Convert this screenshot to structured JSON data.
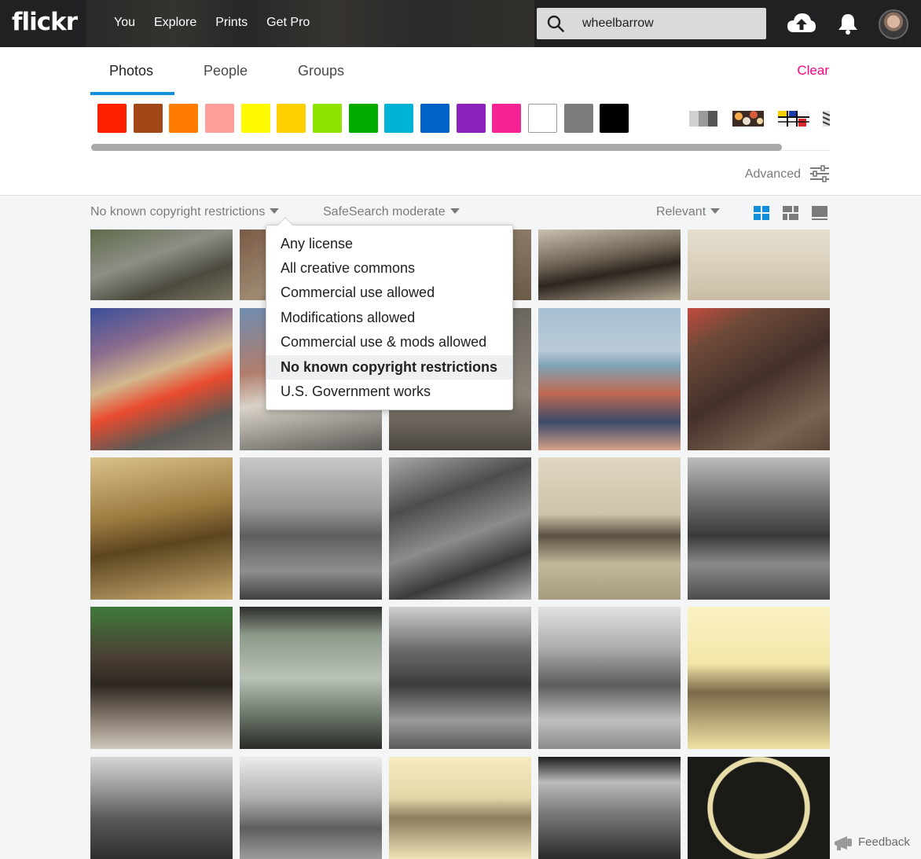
{
  "header": {
    "logo": "flickr",
    "nav": [
      "You",
      "Explore",
      "Prints",
      "Get Pro"
    ],
    "search_value": "wheelbarrow"
  },
  "tabs": [
    "Photos",
    "People",
    "Groups"
  ],
  "active_tab": "Photos",
  "clear_label": "Clear",
  "colors": [
    "#ff2000",
    "#a24615",
    "#ff7c00",
    "#ff9f9c",
    "#fffa00",
    "#ffcf00",
    "#90e200",
    "#00ab00",
    "#00b2d4",
    "#0062c6",
    "#8c20ba",
    "#f52394",
    "#ffffff",
    "#7c7c7c",
    "#000000"
  ],
  "styles": [
    "black-and-white-icon",
    "shallow-depth-of-field-icon",
    "minimalism-icon",
    "patterns-icon"
  ],
  "advanced_label": "Advanced",
  "filters": {
    "license": "No known copyright restrictions",
    "safesearch": "SafeSearch moderate",
    "sort": "Relevant"
  },
  "license_options": [
    "Any license",
    "All creative commons",
    "Commercial use allowed",
    "Modifications allowed",
    "Commercial use & mods allowed",
    "No known copyright restrictions",
    "U.S. Government works"
  ],
  "selected_license": "No known copyright restrictions",
  "accent": "#128fdc",
  "clear_color": "#ff0084",
  "photos": [
    {
      "name": "wheelbarrow-in-garden",
      "bg": "linear-gradient(160deg,#5e6b4a 0%,#8d8f86 40%,#4c4a3f 70%,#7a7560 100%)"
    },
    {
      "name": "people-street-1",
      "bg": "linear-gradient(150deg,#7a5a46 0%,#9e8a72 50%,#5b4a3a 100%)"
    },
    {
      "name": "hidden-photo-3",
      "bg": "linear-gradient(180deg,#8a7a66,#6b5a48)"
    },
    {
      "name": "sepia-figure-beach",
      "bg": "linear-gradient(170deg,#c9c1b0 0%,#6f6354 40%,#2c2620 60%,#b5a993 100%)"
    },
    {
      "name": "engraving-wheelbarrow",
      "bg": "linear-gradient(180deg,#e6dfcf 0%,#d7cdb8 60%,#c8bca3 100%)"
    },
    {
      "name": "festival-crowd",
      "bg": "linear-gradient(160deg,#3a4f9a 0%,#8a6b8e 25%,#d2b78e 45%,#e94b2e 60%,#5c5a55 80%,#7b776f 100%)"
    },
    {
      "name": "street-crowd-2",
      "bg": "linear-gradient(170deg,#6f8cb0 0%,#b27e6c 40%,#d8d2c8 60%,#5b5955 100%)"
    },
    {
      "name": "metal-wheelbarrow",
      "bg": "linear-gradient(180deg,#6b6660,#8a8379 60%,#4a4540)"
    },
    {
      "name": "beach-crowd",
      "bg": "linear-gradient(180deg,#a7c0d3 0%,#b9cad6 30%,#7fa3b8 40%,#c06a52 60%,#3b4a6a 80%,#d6a187 100%)"
    },
    {
      "name": "wooden-barrow-closeup",
      "bg": "linear-gradient(150deg,#c44a3e 0%,#6d4a39 20%,#43302a 50%,#7a6250 80%,#5a4638 100%)"
    },
    {
      "name": "van-gogh-sketch",
      "bg": "linear-gradient(170deg,#d9c28a 0%,#9c7a3f 40%,#5c4520 60%,#c7ab70 100%)"
    },
    {
      "name": "bw-house-lawn",
      "bg": "linear-gradient(180deg,#c8c8c6 0%,#9a9a98 35%,#5e5e5c 55%,#8e8e8c 80%,#3f3f3d 100%)"
    },
    {
      "name": "bw-cart-wheel",
      "bg": "linear-gradient(160deg,#a8a8a6 0%,#4d4d4b 30%,#8c8c8a 55%,#3a3a38 75%,#b3b3b1 100%)"
    },
    {
      "name": "sepia-women-barrow",
      "bg": "linear-gradient(180deg,#e0d8c2 0%,#cdc3a8 40%,#5a5244 55%,#c2b799 75%,#a89c80 100%)"
    },
    {
      "name": "bw-men-barrow",
      "bg": "linear-gradient(180deg,#bdbdbb 0%,#707070 30%,#3a3a3a 55%,#8a8a88 75%,#4c4c4a 100%)"
    },
    {
      "name": "bust-statue",
      "bg": "linear-gradient(180deg,#3f7a3a 0%,#4a3f34 35%,#2e2822 55%,#7a6e62 75%,#d0c8bc 100%)"
    },
    {
      "name": "lantern-slide-pavilion",
      "bg": "linear-gradient(180deg,#2c2c2a 0%,#8d9a8a 20%,#b9c2b6 50%,#6e7a6c 75%,#2a2a28 100%)"
    },
    {
      "name": "bw-woman-park",
      "bg": "linear-gradient(180deg,#cfcfcd 0%,#6c6c6a 30%,#3c3c3a 55%,#9a9a98 80%,#5a5a58 100%)"
    },
    {
      "name": "bw-gate-train",
      "bg": "linear-gradient(180deg,#e2e2e0 0%,#aaaaa8 30%,#5c5c5a 55%,#c0c0be 80%,#8a8a88 100%)"
    },
    {
      "name": "cartoon-barrow",
      "bg": "linear-gradient(180deg,#fbf2c4 0%,#f2e6a8 40%,#7a6a4a 60%,#efe2a2 100%)"
    },
    {
      "name": "bw-factory-yard",
      "bg": "linear-gradient(180deg,#d6d6d4 0%,#9c9c9a 30%,#5a5a58 60%,#2e2e2c 100%)"
    },
    {
      "name": "bw-village-street",
      "bg": "linear-gradient(180deg,#ececea 0%,#b0b0ae 40%,#5e5e5c 70%,#9c9c9a 100%)"
    },
    {
      "name": "etching-angel",
      "bg": "linear-gradient(180deg,#f5ebc0 0%,#e2d7a8 40%,#8a7e5e 60%,#efe4b6 100%)"
    },
    {
      "name": "bw-factory-chimney",
      "bg": "linear-gradient(180deg,#1a1a1a 0%,#bcbcba 25%,#7a7a78 55%,#2a2a28 100%)"
    },
    {
      "name": "hands-emblem",
      "bg": "radial-gradient(circle at 50% 50%,#1a1a16 0 52%,#e8dda8 53% 58%,#1a1a16 59%)"
    }
  ],
  "feedback_label": "Feedback"
}
